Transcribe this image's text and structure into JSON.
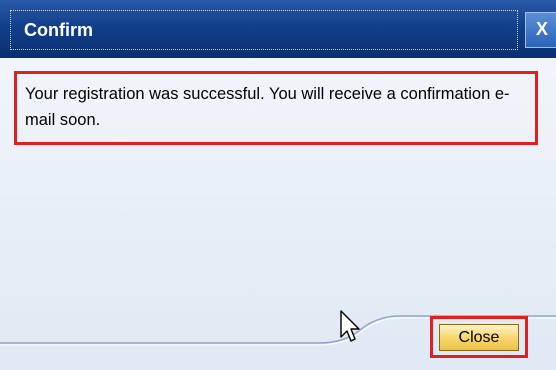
{
  "dialog": {
    "title": "Confirm",
    "close_icon_glyph": "X",
    "message": "Your registration was successful. You will receive a confirmation e-mail soon.",
    "close_label": "Close"
  },
  "colors": {
    "title_bar": "#123f8c",
    "highlight": "#e02020",
    "button_fill": "#f7d870"
  },
  "icons": {
    "window_close": "close-icon",
    "pointer": "arrow-cursor-icon"
  }
}
